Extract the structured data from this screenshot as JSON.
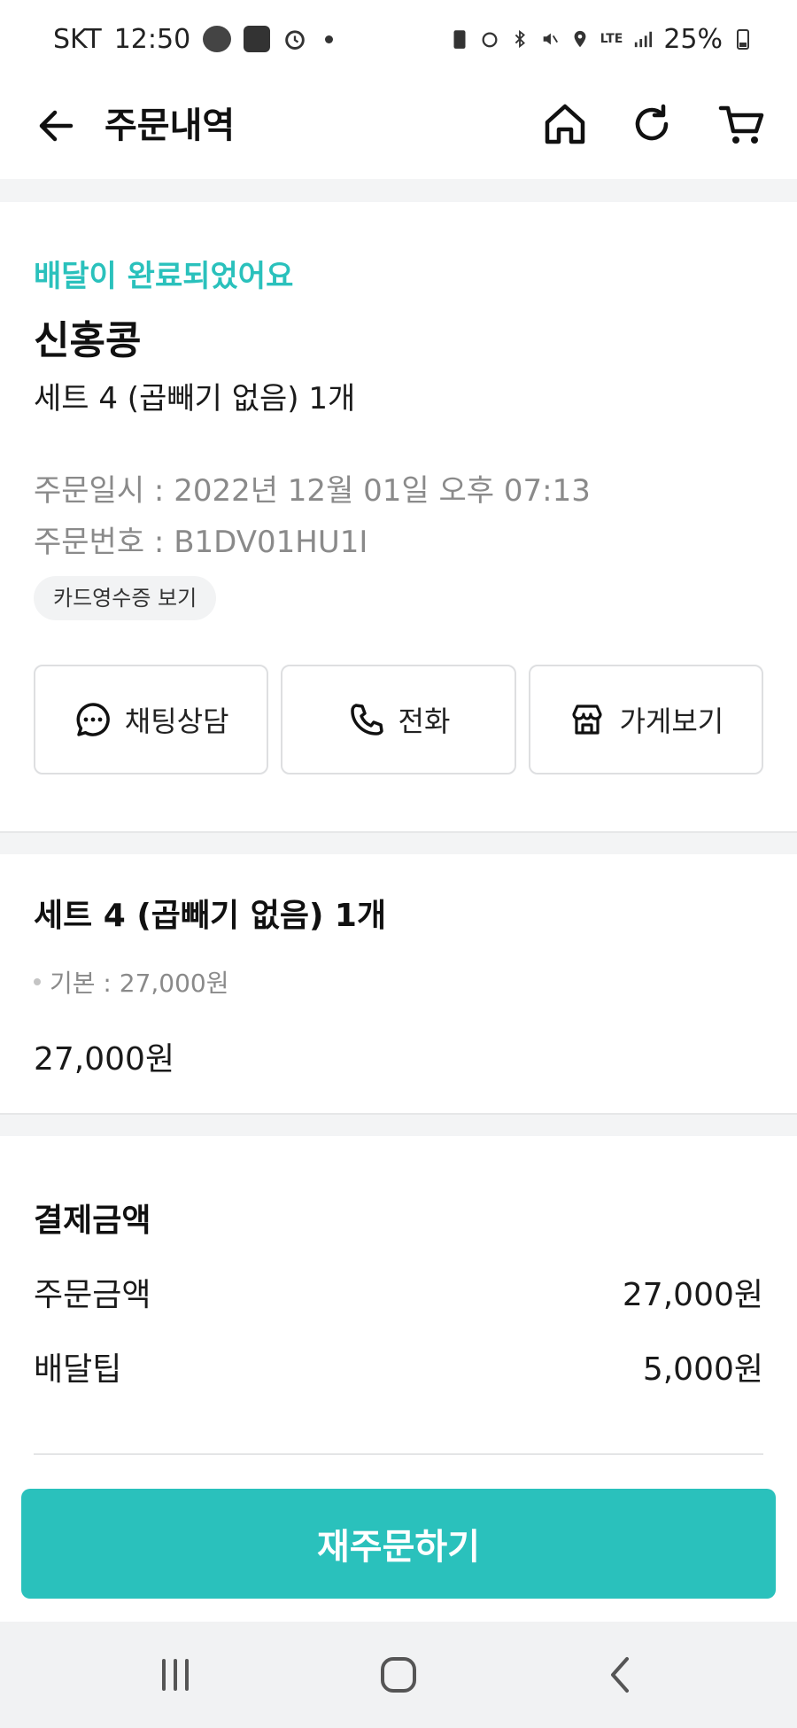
{
  "status_bar": {
    "carrier": "SKT",
    "time": "12:50",
    "battery": "25%",
    "network": "LTE"
  },
  "header": {
    "title": "주문내역"
  },
  "order": {
    "status": "배달이 완료되었어요",
    "store_name": "신홍콩",
    "summary": "세트 4 (곱빼기 없음) 1개",
    "order_datetime": "주문일시 : 2022년 12월 01일 오후 07:13",
    "order_number": "주문번호 : B1DV01HU1I",
    "receipt_label": "카드영수증 보기"
  },
  "actions": {
    "chat_label": "채팅상담",
    "call_label": "전화",
    "store_label": "가게보기"
  },
  "item": {
    "name": "세트 4 (곱빼기 없음) 1개",
    "option": "기본 : 27,000원",
    "price": "27,000원"
  },
  "payment": {
    "title": "결제금액",
    "order_amount_label": "주문금액",
    "order_amount": "27,000원",
    "delivery_tip_label": "배달팁",
    "delivery_tip": "5,000원"
  },
  "reorder_label": "재주문하기",
  "colors": {
    "accent": "#2ac1bc"
  }
}
